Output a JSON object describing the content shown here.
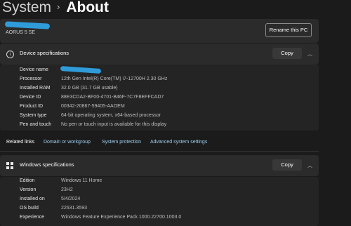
{
  "breadcrumb": {
    "root": "System",
    "separator": "›",
    "current": "About"
  },
  "pc": {
    "model": "AORUS 5 SE",
    "rename_label": "Rename this PC"
  },
  "device_specs": {
    "title": "Device specifications",
    "copy_label": "Copy",
    "rows": [
      {
        "key": "Device name",
        "value": ""
      },
      {
        "key": "Processor",
        "value": "12th Gen Intel(R) Core(TM) i7-12700H   2.30 GHz"
      },
      {
        "key": "Installed RAM",
        "value": "32.0 GB (31.7 GB usable)"
      },
      {
        "key": "Device ID",
        "value": "88E3CDA2-BF00-4701-B46F-7C7F8EFFCAD7"
      },
      {
        "key": "Product ID",
        "value": "00342-20867-59405-AAOEM"
      },
      {
        "key": "System type",
        "value": "64-bit operating system, x64-based processor"
      },
      {
        "key": "Pen and touch",
        "value": "No pen or touch input is available for this display"
      }
    ]
  },
  "related_links": {
    "label": "Related links",
    "links": [
      "Domain or workgroup",
      "System protection",
      "Advanced system settings"
    ]
  },
  "windows_specs": {
    "title": "Windows specifications",
    "copy_label": "Copy",
    "rows": [
      {
        "key": "Edition",
        "value": "Windows 11 Home"
      },
      {
        "key": "Version",
        "value": "23H2"
      },
      {
        "key": "Installed on",
        "value": "5/4/2024"
      },
      {
        "key": "OS build",
        "value": "22631.3593"
      },
      {
        "key": "Experience",
        "value": "Windows Feature Experience Pack 1000.22700.1003.0"
      }
    ]
  },
  "icons": {
    "info": "info-icon",
    "windows": "windows-logo-icon",
    "chevron": "chevron-up-icon"
  },
  "colors": {
    "background": "#1b1b1b",
    "card": "#2b2b2b",
    "link": "#9fcff0",
    "redaction": "#2f9bd9"
  }
}
